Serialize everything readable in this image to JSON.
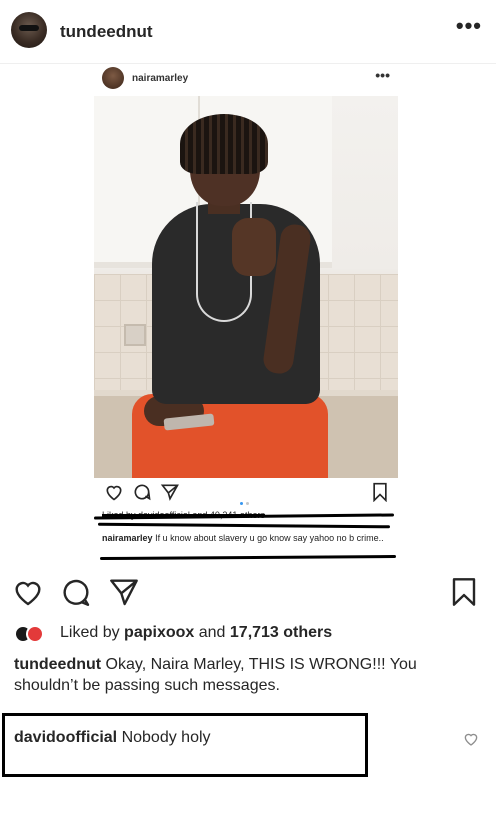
{
  "header": {
    "username": "tundeednut",
    "more": "•••"
  },
  "embed": {
    "username": "nairamarley",
    "more": "•••",
    "likes_text": "Liked by davidoofficial and 40,241 others",
    "caption_user": "nairamarley",
    "caption_text": "If u know about slavery u go know say yahoo no b crime.."
  },
  "likes": {
    "prefix": "Liked by",
    "user": "papixoox",
    "middle": "and",
    "count": "17,713 others"
  },
  "caption": {
    "user": "tundeednut",
    "text": "Okay, Naira Marley, THIS IS WRONG!!! You shouldn’t be passing such messages."
  },
  "comment": {
    "user": "davidoofficial",
    "text": "Nobody holy"
  },
  "icons": [
    "heart-icon",
    "comment-icon",
    "share-icon",
    "bookmark-icon",
    "more-icon"
  ]
}
